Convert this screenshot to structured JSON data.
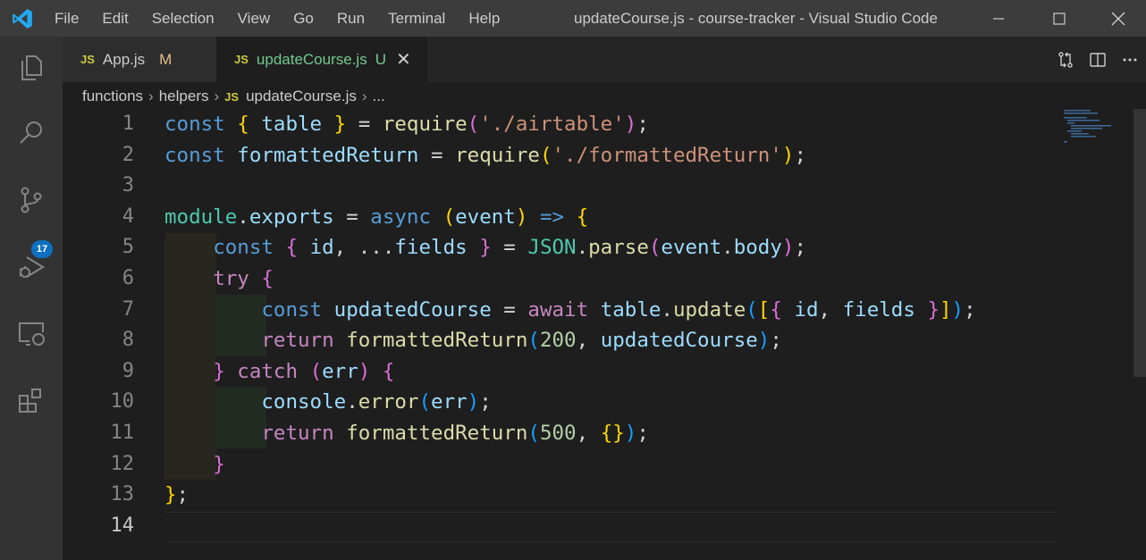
{
  "window": {
    "title": "updateCourse.js - course-tracker - Visual Studio Code",
    "menu": [
      "File",
      "Edit",
      "Selection",
      "View",
      "Go",
      "Run",
      "Terminal",
      "Help"
    ]
  },
  "activity_bar": {
    "icons": [
      "explorer-icon",
      "search-icon",
      "source-control-icon",
      "run-debug-icon",
      "remote-explorer-icon",
      "extensions-icon"
    ],
    "source_control_badge": "17"
  },
  "tabs": [
    {
      "icon": "JS",
      "label": "App.js",
      "status": "M",
      "active": false
    },
    {
      "icon": "JS",
      "label": "updateCourse.js",
      "status": "U",
      "active": true
    }
  ],
  "breadcrumb": [
    "functions",
    "helpers",
    "updateCourse.js",
    "..."
  ],
  "breadcrumb_icon": "JS",
  "editor": {
    "line_numbers": [
      "1",
      "2",
      "3",
      "4",
      "5",
      "6",
      "7",
      "8",
      "9",
      "10",
      "11",
      "12",
      "13",
      "14"
    ],
    "active_line": "14"
  },
  "colors": {
    "titlebar": "#3c3c3c",
    "activity_bar": "#333333",
    "editor_bg": "#1e1e1e",
    "accent": "#0e70c0",
    "modified": "#e2c08d",
    "untracked": "#73c991"
  }
}
